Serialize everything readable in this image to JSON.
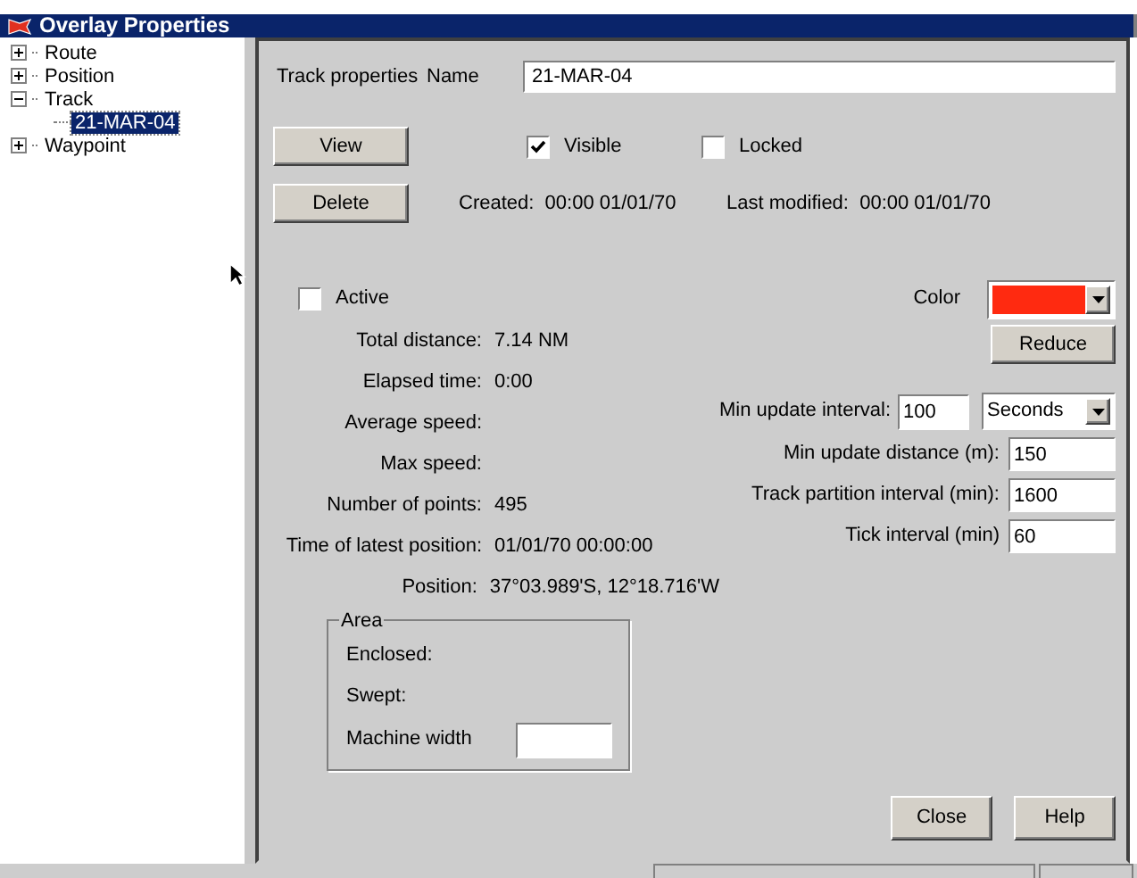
{
  "window": {
    "title": "Overlay Properties"
  },
  "tree": [
    {
      "label": "Route",
      "expanded": false,
      "selected": false
    },
    {
      "label": "Position",
      "expanded": false,
      "selected": false
    },
    {
      "label": "Track",
      "expanded": true,
      "selected": false,
      "children": [
        {
          "label": "21-MAR-04",
          "selected": true
        }
      ]
    },
    {
      "label": "Waypoint",
      "expanded": false,
      "selected": false
    }
  ],
  "header": {
    "title": "Track properties",
    "name_label": "Name",
    "name_value": "21-MAR-04"
  },
  "view_button": "View",
  "delete_button": "Delete",
  "visible": {
    "label": "Visible",
    "checked": true
  },
  "locked": {
    "label": "Locked",
    "checked": false
  },
  "created": "Created:  00:00 01/01/70",
  "last_modified": "Last modified:  00:00 01/01/70",
  "active": {
    "label": "Active",
    "checked": false
  },
  "color": {
    "label": "Color",
    "color": "#ff2a10"
  },
  "reduce_button": "Reduce",
  "stats": [
    {
      "label": "Total distance:",
      "value": "7.14 NM"
    },
    {
      "label": "Elapsed time:",
      "value": "0:00"
    },
    {
      "label": "Average speed:"
    },
    {
      "label": "Max speed:"
    },
    {
      "label": "Number of points:",
      "value": "495"
    },
    {
      "label": "Time of latest position:",
      "value": "01/01/70 00:00:00"
    },
    {
      "label": "Position:",
      "value": "37°03.989'S, 12°18.716'W"
    }
  ],
  "min_update_interval": {
    "label": "Min update interval:",
    "value": "100",
    "unit": "Seconds"
  },
  "settings": [
    {
      "label": "Min update distance (m):",
      "value": "150"
    },
    {
      "label": "Track partition interval (min):",
      "value": "1600"
    },
    {
      "label": "Tick interval (min)",
      "value": "60"
    }
  ],
  "area": {
    "title": "Area",
    "items": [
      "Enclosed:",
      "Swept:"
    ],
    "machine_width_label": "Machine width"
  },
  "footer_buttons": [
    "Close",
    "Help"
  ]
}
